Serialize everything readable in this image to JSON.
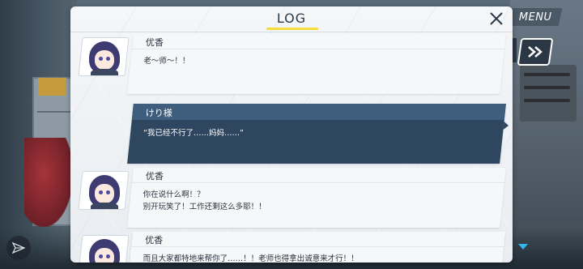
{
  "window": {
    "title": "LOG"
  },
  "top_right": {
    "menu_label": "MENU"
  },
  "log_entries": [
    {
      "speaker": "优香",
      "text": "老～师～！！",
      "style": "character"
    },
    {
      "speaker": "けり様",
      "text": "“我已经不行了……妈妈……”",
      "style": "player"
    },
    {
      "speaker": "优香",
      "text": "你在说什么啊！？\n别开玩笑了！工作还剩这么多耶！！",
      "style": "character"
    },
    {
      "speaker": "优香",
      "text": "而且大家都特地来帮你了……！！老师也得拿出诚意来才行！！",
      "style": "character"
    }
  ],
  "icons": {
    "close": "close-icon",
    "skip": "fast-forward-icon",
    "send": "paper-plane-icon",
    "scroll_more": "triangle-down-icon"
  },
  "colors": {
    "title_underline": "#f3dc3c",
    "player_bubble": "#2f4660",
    "player_name_bar": "#3f5d7d",
    "scroll_arrow": "#32b6f0"
  }
}
